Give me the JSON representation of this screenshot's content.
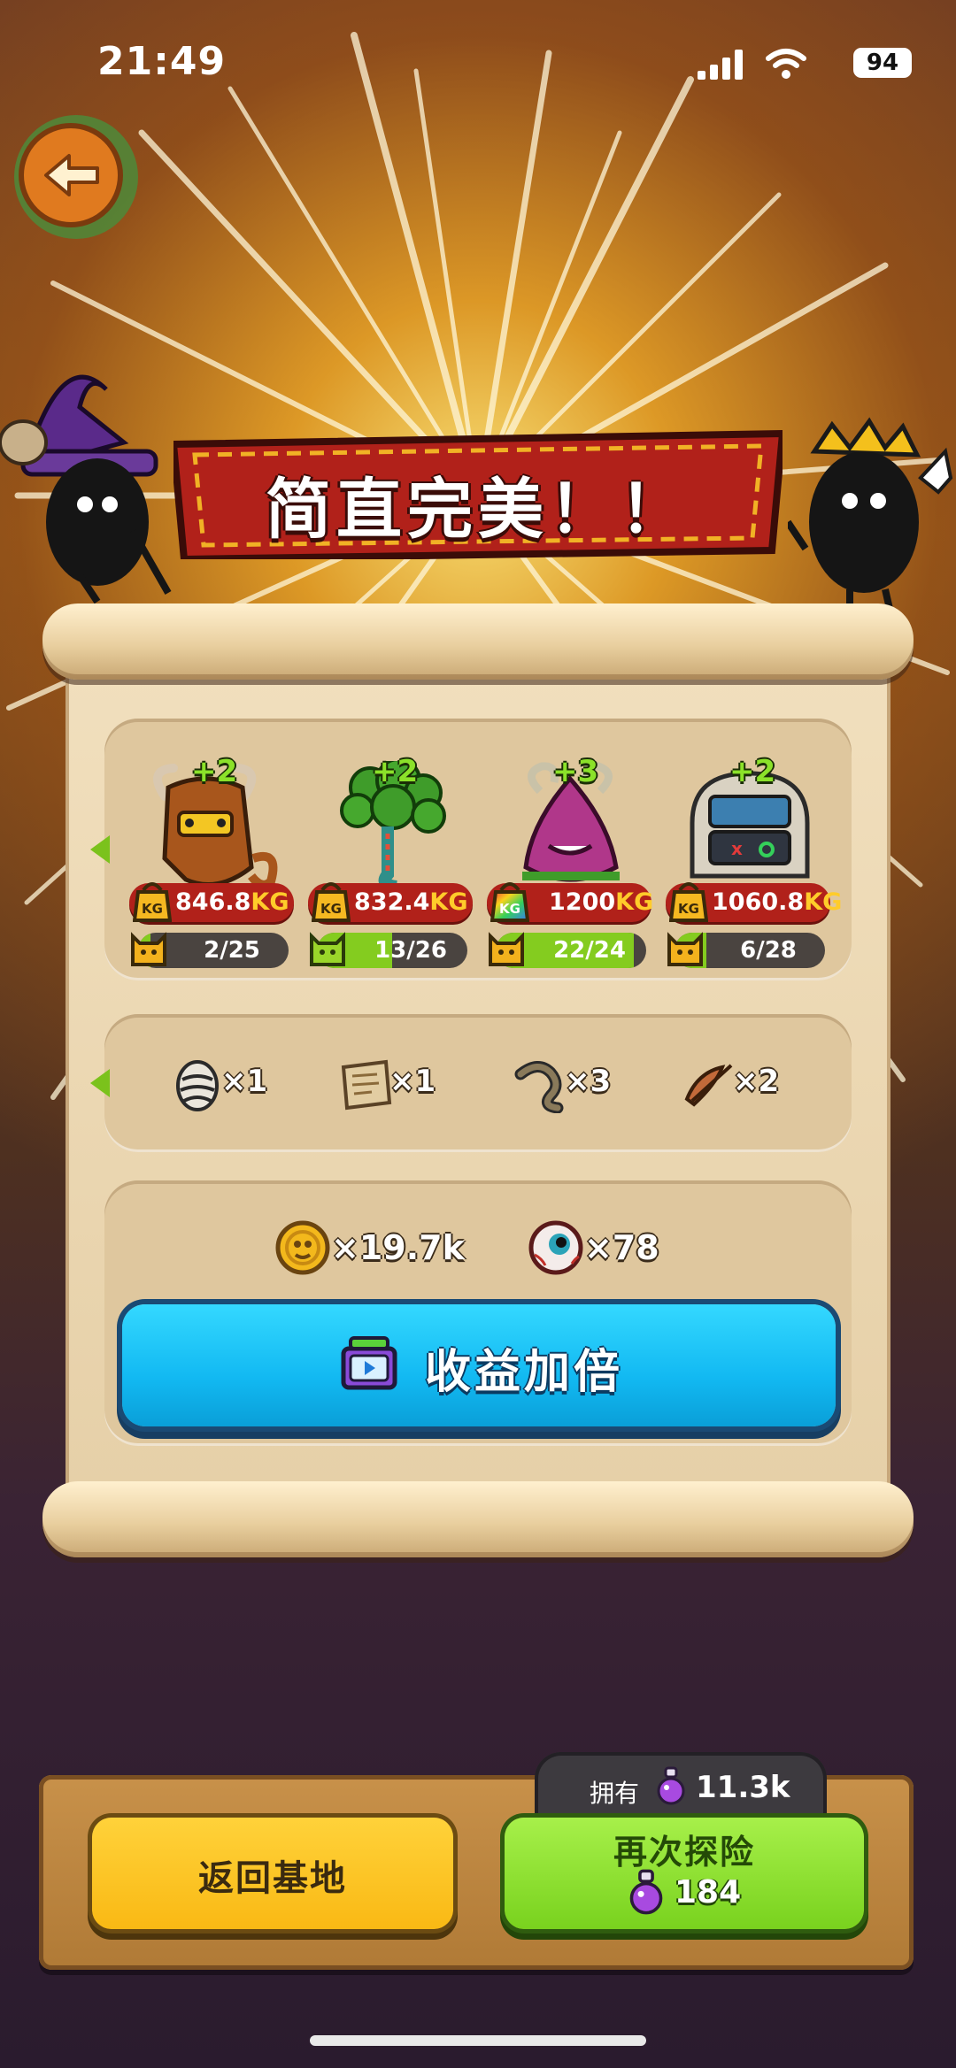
{
  "status_bar": {
    "time": "21:49",
    "battery": "94"
  },
  "banner": {
    "title": "简直完美！！"
  },
  "monsters": [
    {
      "plus": "+2",
      "weight": "846.8",
      "unit": "KG",
      "count": "2/25",
      "progress": 0.08
    },
    {
      "plus": "+2",
      "weight": "832.4",
      "unit": "KG",
      "count": "13/26",
      "progress": 0.5
    },
    {
      "plus": "+3",
      "weight": "1200",
      "unit": "KG",
      "count": "22/24",
      "progress": 0.92
    },
    {
      "plus": "+2",
      "weight": "1060.8",
      "unit": "KG",
      "count": "6/28",
      "progress": 0.21
    }
  ],
  "items": [
    {
      "icon": "egg-icon",
      "qty": "×1"
    },
    {
      "icon": "map-scroll-icon",
      "qty": "×1"
    },
    {
      "icon": "worm-icon",
      "qty": "×3"
    },
    {
      "icon": "slingshot-icon",
      "qty": "×2"
    }
  ],
  "rewards": [
    {
      "icon": "coin-icon",
      "value": "×19.7k"
    },
    {
      "icon": "eyeball-icon",
      "value": "×78"
    }
  ],
  "double_button": {
    "label": "收益加倍",
    "icon": "tv-ad-icon"
  },
  "owned": {
    "label": "拥有",
    "value": "11.3k",
    "icon": "potion-icon"
  },
  "buttons": {
    "home": "返回基地",
    "again": "再次探险",
    "again_cost": "184"
  },
  "colors": {
    "banner_red": "#b1211a",
    "double_blue": "#12b9f2",
    "home_yellow": "#f9b914",
    "again_green": "#79d21e",
    "progress_green": "#84cc1f"
  }
}
